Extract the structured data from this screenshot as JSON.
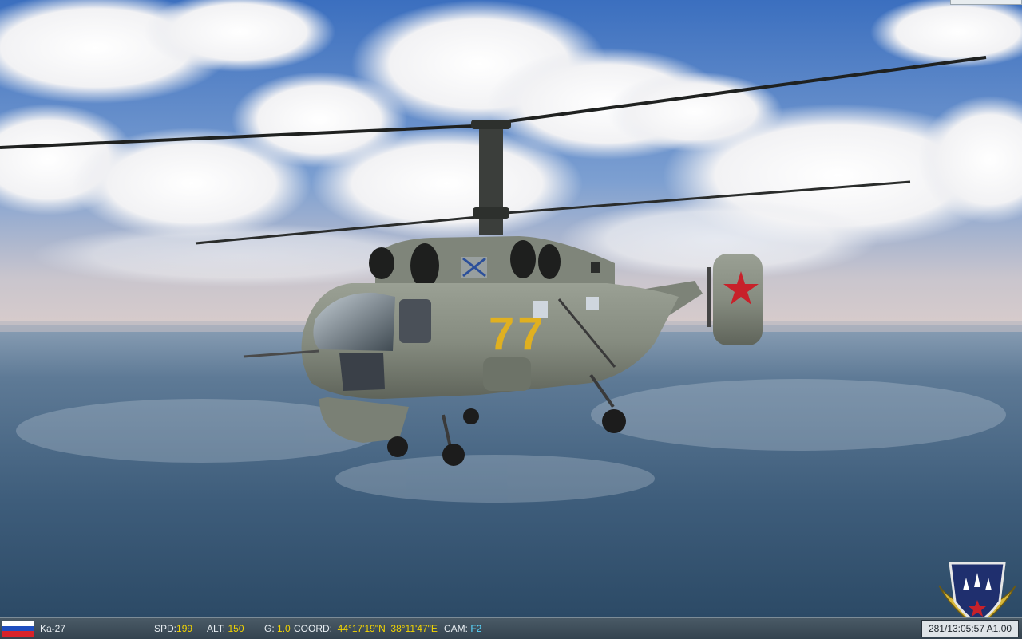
{
  "hud": {
    "aircraft": "Ka-27",
    "spd_label": "SPD:",
    "spd_value": "199",
    "alt_label": "ALT:",
    "alt_value": "150",
    "g_label": "G:",
    "g_value": "1.0",
    "coord_label": "COORD:",
    "lat": "44°17'19\"N",
    "lon": "38°11'47\"E",
    "cam_label": "CAM:",
    "cam_value": "F2",
    "time_readout": "281/13:05:57 A1.00",
    "flag_colors": [
      "#ffffff",
      "#1f4fbf",
      "#d8232a"
    ]
  },
  "aircraft_markings": {
    "tail_number": "77",
    "star_color": "#c8212a",
    "number_color": "#e0b020"
  },
  "scene": {
    "sky_top": "#3f73c1",
    "horizon": "#cfc9c9",
    "sea": "#3c5a77",
    "fuselage": "#858b7f"
  }
}
